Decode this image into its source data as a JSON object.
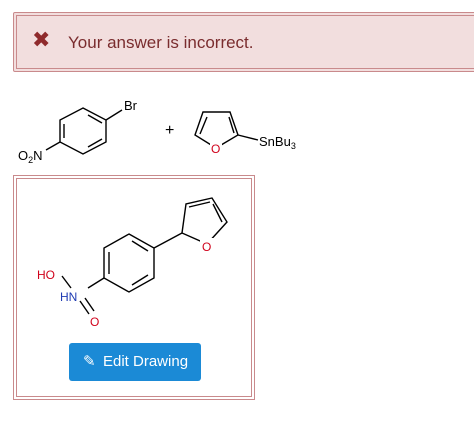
{
  "feedback": {
    "icon": "close-x-icon",
    "message": "Your answer is incorrect.",
    "color_bg": "#f2dede",
    "color_text": "#7a2c2e"
  },
  "reaction": {
    "reactant1": {
      "br_label": "Br",
      "no2_label": "O",
      "no2_sub": "2",
      "no2_n": "N"
    },
    "plus": "+",
    "reactant2": {
      "o_label": "O",
      "sn_label": "SnBu",
      "sn_sub": "3"
    }
  },
  "answer": {
    "o_label": "O",
    "ho_label": "HO",
    "hn_label": "HN",
    "o2_label": "O",
    "edit_button": "Edit Drawing",
    "button_color": "#1b8ad6"
  }
}
